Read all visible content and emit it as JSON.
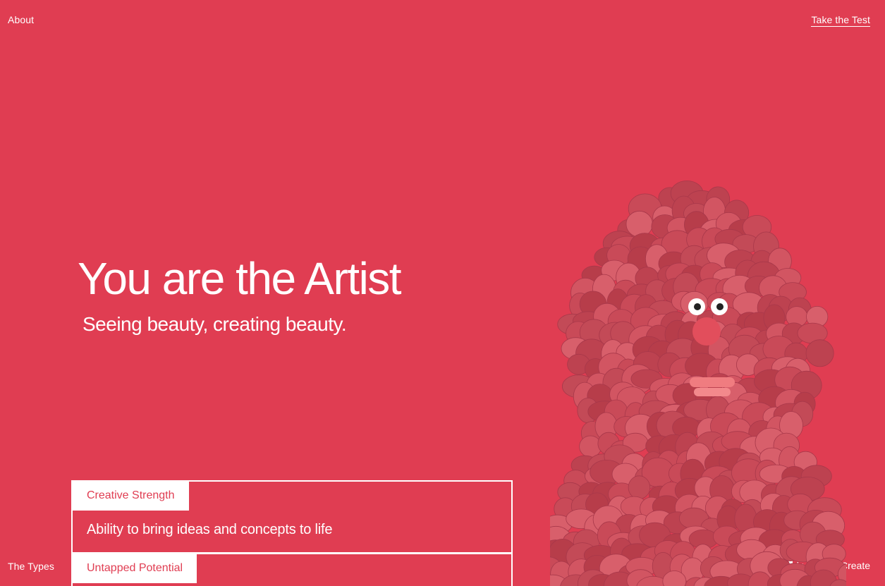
{
  "nav": {
    "about": "About",
    "take_test": "Take the Test",
    "the_types": "The Types",
    "brand": "by Adobe Create"
  },
  "hero": {
    "title": "You are the Artist",
    "subtitle": "Seeing beauty, creating beauty."
  },
  "cards": [
    {
      "tab": "Creative Strength",
      "body": "Ability to bring ideas and concepts to life"
    },
    {
      "tab": "Untapped Potential",
      "body": ""
    }
  ],
  "colors": {
    "background": "#e03d52",
    "text": "#ffffff",
    "character": "#c94a58"
  },
  "icons": {
    "brand_logo": "adobe-logo-icon"
  }
}
